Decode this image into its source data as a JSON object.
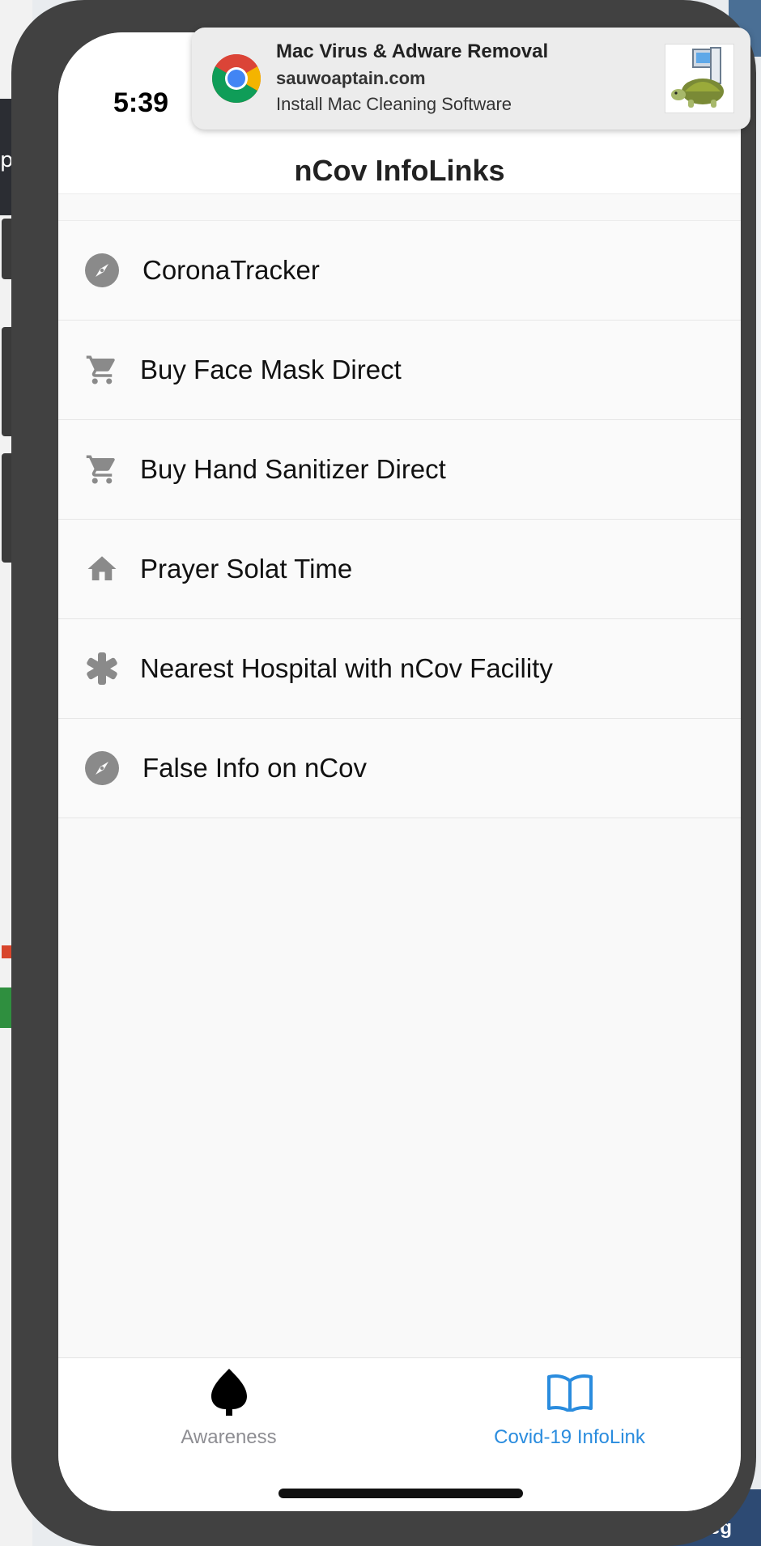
{
  "status_bar": {
    "time": "5:39"
  },
  "notification": {
    "title": "Mac Virus & Adware Removal",
    "site": "sauwoaptain.com",
    "message": "Install Mac Cleaning Software"
  },
  "nav": {
    "title": "nCov InfoLinks"
  },
  "list": {
    "items": [
      {
        "label": "CoronaTracker",
        "icon": "compass-icon"
      },
      {
        "label": "Buy Face Mask Direct",
        "icon": "cart-icon"
      },
      {
        "label": "Buy Hand Sanitizer Direct",
        "icon": "cart-icon"
      },
      {
        "label": "Prayer Solat Time",
        "icon": "home-icon"
      },
      {
        "label": "Nearest Hospital with nCov Facility",
        "icon": "asterisk-icon"
      },
      {
        "label": "False Info on nCov",
        "icon": "compass-icon"
      }
    ]
  },
  "tabbar": {
    "tabs": [
      {
        "label": "Awareness",
        "icon": "leaf-icon",
        "active": false
      },
      {
        "label": "Covid-19 InfoLink",
        "icon": "book-icon",
        "active": true
      }
    ]
  },
  "background": {
    "partial_glyph": "p",
    "partial_text": "eg"
  },
  "colors": {
    "accent": "#2a8cde",
    "inactive": "#8e8e93",
    "icon_gray": "#8a8a8a",
    "frame": "#414141"
  }
}
